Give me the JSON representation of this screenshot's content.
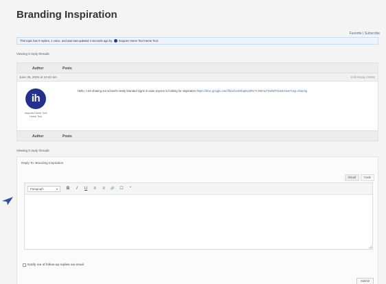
{
  "page": {
    "title": "Branding Inspiration",
    "favorite_label": "Favorite",
    "links_separator": " | ",
    "subscribe_label": "Subscribe"
  },
  "notice": {
    "text": "This topic has 0 replies, 1 voice, and was last updated 3 seconds ago by",
    "author": "Iroquois Home Tool Home Tool."
  },
  "viewing": {
    "top": "Viewing 0 reply threads",
    "bottom": "Viewing 0 reply threads"
  },
  "table": {
    "col_author": "Author",
    "col_posts": "Posts",
    "footer_author": "Author",
    "footer_posts": "Posts"
  },
  "reply": {
    "date": "June 26, 2025 at 10:40 am",
    "meta": "Edit  Reply  #5935",
    "avatar_initials": "ih",
    "author_name": "Iroquois Home Tool Home Tool",
    "content_text": "Hello, I am sharing our school's newly branded signs in case anyone is looking for inspiration",
    "content_link": "https://drive.google.com/file/d/1x4Kbq9aJ3Rv7YZt0mLP2wN8Tdue5/view?usp=sharing"
  },
  "reply_form": {
    "legend": "Reply To: Branding Inspiration",
    "tab_visual": "Visual",
    "tab_code": "Code",
    "format_value": "Paragraph",
    "toolbar": [
      "B",
      "I",
      "U",
      "≡",
      "≡",
      "🔗",
      "☐",
      "“"
    ],
    "notify_label": "Notify me of follow-up replies via email",
    "submit_label": "Submit"
  },
  "colors": {
    "accent": "#3a6fb0",
    "avatar_bg": "#23318c",
    "cursor": "#2d4fa8"
  }
}
